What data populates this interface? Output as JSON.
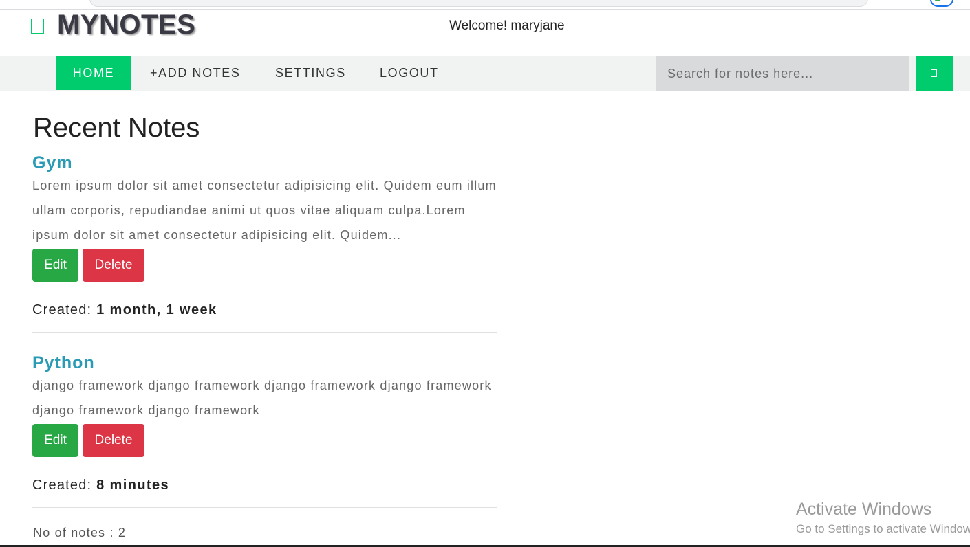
{
  "brand": {
    "name": "MYNOTES",
    "accent_color": "#00cc6e",
    "icon": "square-outline-icon"
  },
  "header": {
    "welcome": "Welcome! maryjane"
  },
  "nav": {
    "items": [
      {
        "label": "HOME",
        "active": true
      },
      {
        "label": "+ADD NOTES",
        "active": false
      },
      {
        "label": "SETTINGS",
        "active": false
      },
      {
        "label": "LOGOUT",
        "active": false
      }
    ],
    "search": {
      "placeholder": "Search for notes here...",
      "value": "",
      "button_icon": "search-icon"
    }
  },
  "main": {
    "title": "Recent Notes",
    "notes": [
      {
        "title": "Gym",
        "body": "Lorem ipsum dolor sit amet consectetur adipisicing elit. Quidem eum illum ullam corporis, repudiandae animi ut quos vitae aliquam culpa.Lorem ipsum dolor sit amet consectetur adipisicing elit. Quidem...",
        "edit_label": "Edit",
        "delete_label": "Delete",
        "created_label": "Created:",
        "created_value": "1 month, 1 week"
      },
      {
        "title": "Python",
        "body": "django framework django framework django framework django framework django framework django framework",
        "edit_label": "Edit",
        "delete_label": "Delete",
        "created_label": "Created:",
        "created_value": "8 minutes"
      }
    ],
    "count_text": "No of notes : 2"
  },
  "watermark": {
    "title": "Activate Windows",
    "subtitle": "Go to Settings to activate Windows."
  },
  "colors": {
    "edit": "#28a745",
    "delete": "#dc3545",
    "note_title": "#2a9bb5",
    "nav_bg": "#f1f2f2",
    "search_bg": "#d9dadb"
  }
}
